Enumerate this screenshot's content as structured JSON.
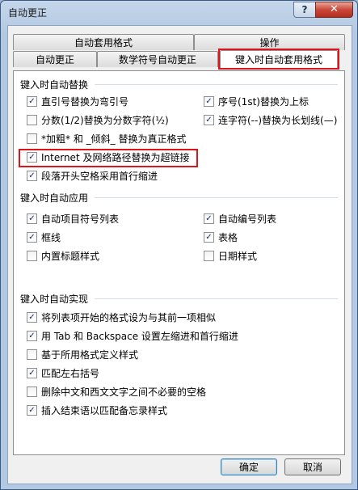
{
  "window": {
    "title": "自动更正",
    "help_label": "?",
    "close_label": "✕"
  },
  "tabs_row1": [
    {
      "label": "自动套用格式"
    },
    {
      "label": "操作"
    }
  ],
  "tabs_row2": [
    {
      "label": "自动更正"
    },
    {
      "label": "数学符号自动更正"
    },
    {
      "label": "键入时自动套用格式",
      "active": true
    }
  ],
  "sections": [
    {
      "title": "键入时自动替换",
      "options": [
        {
          "label": "直引号替换为弯引号",
          "checked": true
        },
        {
          "label": "序号(1st)替换为上标",
          "checked": true
        },
        {
          "label": "分数(1/2)替换为分数字符(½)",
          "checked": false
        },
        {
          "label": "连字符(--)替换为长划线(—)",
          "checked": true
        },
        {
          "label": "*加粗* 和 _倾斜_ 替换为真正格式",
          "checked": false
        },
        {
          "label": "Internet 及网络路径替换为超链接",
          "checked": true
        },
        {
          "label": "段落开头空格采用首行缩进",
          "checked": true
        }
      ]
    },
    {
      "title": "键入时自动应用",
      "options": [
        {
          "label": "自动项目符号列表",
          "checked": true
        },
        {
          "label": "自动编号列表",
          "checked": true
        },
        {
          "label": "框线",
          "checked": true
        },
        {
          "label": "表格",
          "checked": true
        },
        {
          "label": "内置标题样式",
          "checked": false
        },
        {
          "label": "日期样式",
          "checked": false
        }
      ]
    },
    {
      "title": "键入时自动实现",
      "options": [
        {
          "label": "将列表项开始的格式设为与其前一项相似",
          "checked": true
        },
        {
          "label": "用 Tab 和 Backspace 设置左缩进和首行缩进",
          "checked": true
        },
        {
          "label": "基于所用格式定义样式",
          "checked": false
        },
        {
          "label": "匹配左右括号",
          "checked": true
        },
        {
          "label": "删除中文和西文文字之间不必要的空格",
          "checked": false
        },
        {
          "label": "插入结束语以匹配备忘录样式",
          "checked": true
        }
      ]
    }
  ],
  "buttons": {
    "ok": "确定",
    "cancel": "取消"
  },
  "colors": {
    "highlight": "#e0131b",
    "check": "#1c2a6b"
  }
}
